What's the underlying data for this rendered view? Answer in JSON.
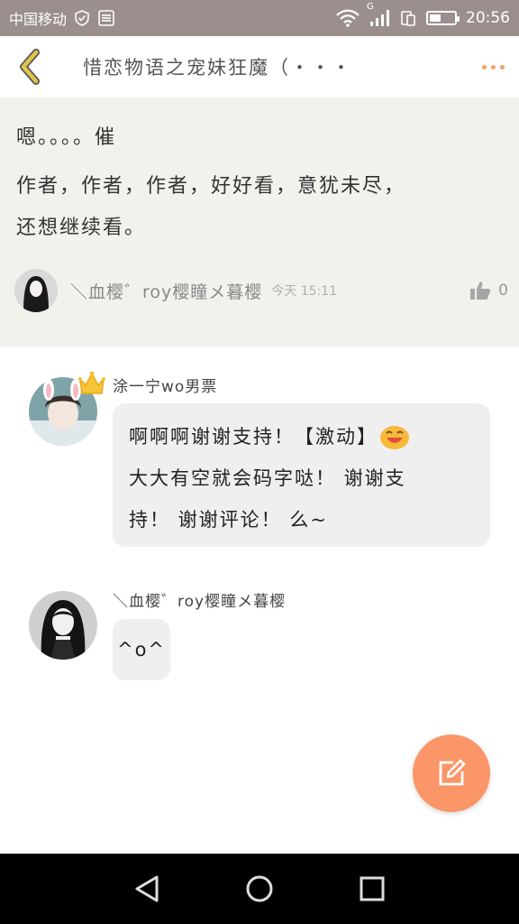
{
  "status_bar": {
    "carrier": "中国移动",
    "network": "G",
    "time": "20:56",
    "battery_level": 0.4,
    "icons": [
      "shield-check-icon",
      "storage-icon",
      "wifi-icon",
      "signal-icon",
      "dual-sim-icon",
      "battery-icon"
    ]
  },
  "header": {
    "back_icon": "chevron-left-icon",
    "title": "惜恋物语之宠妹狂魔（・・・",
    "more_icon": "more-dots-icon"
  },
  "original_comment": {
    "text_line1": "嗯。。。。催",
    "text_line2": "作者，作者，作者，好好看，意犹未尽，",
    "text_line3": "还想继续看。",
    "author": "＼血樱゛roy樱瞳メ暮樱",
    "time": "今天 15:11",
    "like_count": "0"
  },
  "replies": [
    {
      "author": "涂一宁wo男票",
      "line1": "啊啊啊谢谢支持！【激动】",
      "line2": "大大有空就会码字哒！ 谢谢支",
      "line3": "持！ 谢谢评论！ 么~",
      "emoji": "laughing-face-icon"
    },
    {
      "author": "＼血樱゛roy樱瞳メ暮樱",
      "text": "^o^"
    }
  ],
  "fab": {
    "icon": "edit-icon"
  },
  "nav": {
    "icons": [
      "back-triangle-icon",
      "home-circle-icon",
      "recents-square-icon"
    ]
  },
  "colors": {
    "accent": "#fb9668",
    "back_arrow": "#d4b84a",
    "status_bar": "#9a8f8d",
    "origin_bg": "#f0f3ec",
    "bubble_bg": "#efefef"
  }
}
